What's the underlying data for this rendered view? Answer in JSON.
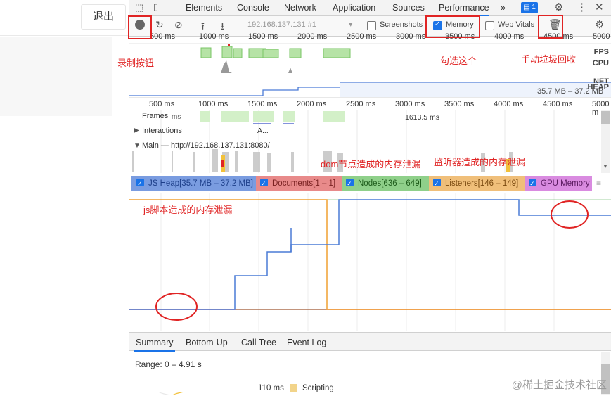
{
  "left_app": {
    "logout_label": "退出"
  },
  "devtools": {
    "tabs": [
      "Elements",
      "Console",
      "Network",
      "Application",
      "Sources",
      "Performance"
    ],
    "more_tabs": "»",
    "issues_count": "1",
    "session_select": "192.168.137.131 #1",
    "screenshots_label": "Screenshots",
    "memory_label": "Memory",
    "webvitals_label": "Web Vitals",
    "overview_ticks": [
      "500 ms",
      "1000 ms",
      "1500 ms",
      "2000 ms",
      "2500 ms",
      "3000 ms",
      "3500 ms",
      "4000 ms",
      "4500 ms",
      "5000"
    ],
    "lane_labels": {
      "fps": "FPS",
      "cpu": "CPU",
      "net": "NET",
      "heap": "HEAP"
    },
    "heap_range": "35.7 MB – 37.2 MB",
    "main_ticks": [
      "500 ms",
      "1000 ms",
      "1500 ms",
      "2000 ms",
      "2500 ms",
      "3000 ms",
      "3500 ms",
      "4000 ms",
      "4500 ms",
      "5000 m"
    ],
    "frames_label": "Frames",
    "frames_ms": "ms",
    "frame_time": "1613.5 ms",
    "interactions_label": "Interactions",
    "interactions_marker": "A...",
    "main_label": "Main — http://192.168.137.131:8080/",
    "legend": {
      "js_heap": "JS Heap[35.7 MB – 37.2 MB]",
      "documents": "Documents[1 – 1]",
      "nodes": "Nodes[636 – 649]",
      "listeners": "Listeners[146 – 149]",
      "gpu": "GPU Memory"
    },
    "bottom_tabs": [
      "Summary",
      "Bottom-Up",
      "Call Tree",
      "Event Log"
    ],
    "range_text": "Range: 0 – 4.91 s",
    "summary_value": "110 ms",
    "summary_label": "Scripting"
  },
  "annotations": {
    "record": "录制按钮",
    "memory_check": "勾选这个",
    "gc": "手动垃圾回收",
    "dom_leak": "dom节点造成的内存泄漏",
    "listener_leak": "监听器造成的内存泄漏",
    "js_leak": "js脚本造成的内存泄漏"
  },
  "watermark": "@稀土掘金技术社区",
  "colors": {
    "accent": "#1a73e8",
    "annotation": "#e02424",
    "heap_line": "#4a7bd6",
    "doc_line": "#e05555",
    "listener_line": "#f0a030",
    "nodes_line": "#48a848"
  }
}
